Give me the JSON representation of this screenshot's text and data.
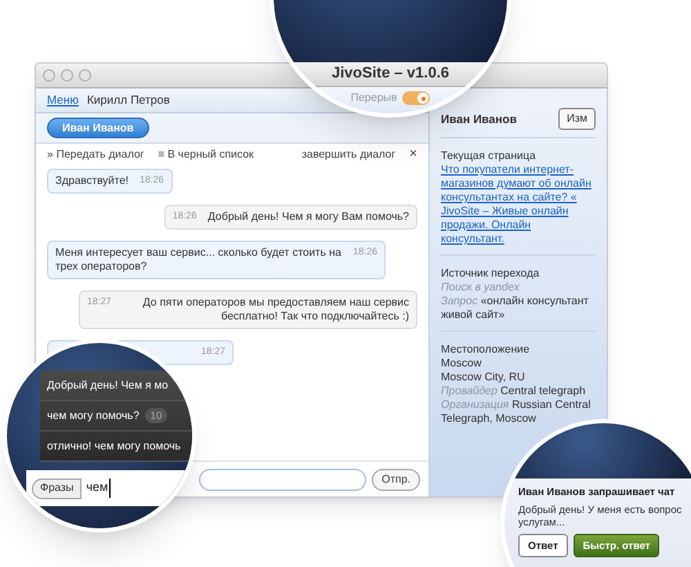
{
  "window": {
    "title": "JivoSite – v1.0.6"
  },
  "header": {
    "menu_link": "Меню",
    "operator": "Кирилл Петров",
    "break_label": "Перерыв",
    "break_on": true
  },
  "chat_tabs": [
    {
      "label": "Иван Иванов",
      "selected": true
    }
  ],
  "actions": [
    {
      "icon": "»",
      "label": "Передать диалог"
    },
    {
      "icon": "≡",
      "label": "В черный список"
    }
  ],
  "end_dialog": {
    "label": "завершить диалог",
    "close": "×"
  },
  "messages": [
    {
      "kind": "visitor",
      "text": "Здравствуйте!",
      "time": "18:26"
    },
    {
      "kind": "operator",
      "text": "Добрый день! Чем я могу Вам помочь?",
      "time": "18:26"
    },
    {
      "kind": "visitor",
      "text": "Меня интересует ваш сервис... сколько будет стоить на трех операторов?",
      "time": "18:26"
    },
    {
      "kind": "operator",
      "text": "До пяти операторов мы предоставляем наш сервис бесплатно! Так что подключайтесь :)",
      "time": "18:27"
    },
    {
      "kind": "visitor",
      "time": "18:27"
    }
  ],
  "phrases": [
    {
      "text": "Добрый день! Чем я мо"
    },
    {
      "text": "чем могу помочь?",
      "count": "10"
    },
    {
      "text": "отлично! чем могу помочь"
    }
  ],
  "composer": {
    "phrases_button": "Фразы",
    "value": "чем",
    "send": "Отпр."
  },
  "visitor": {
    "name": "Иван Иванов",
    "edit": "Изм",
    "sections": [
      {
        "title": "Текущая страница",
        "lines": [
          {
            "kind": "link",
            "value": "Что покупатели интернет-магазинов думают об онлайн консультантах на сайте? « JivoSite – Живые онлайн продажи. Онлайн консультант."
          }
        ]
      },
      {
        "title": "Источник перехода",
        "lines": [
          {
            "kind": "muted",
            "value": "Поиск в yandex"
          },
          {
            "kind": "pair",
            "label": "Запрос",
            "value": "«онлайн консультант живой сайт»"
          }
        ]
      },
      {
        "title": "Местоположение",
        "lines": [
          {
            "kind": "plain",
            "value": "Moscow"
          },
          {
            "kind": "plain",
            "value": "Moscow City, RU"
          },
          {
            "kind": "pair",
            "label": "Провайдер",
            "value": "Central telegraph"
          },
          {
            "kind": "pair",
            "label": "Организация",
            "value": "Russian Central Telegraph, Moscow"
          }
        ]
      }
    ]
  },
  "notification": {
    "title": "Иван Иванов запрашивает чат",
    "lines": [
      "Добрый день! У меня есть вопрос",
      "услугам..."
    ],
    "buttons": [
      {
        "label": "Ответ",
        "kind": "plain"
      },
      {
        "label": "Быстр. ответ",
        "kind": "primary"
      }
    ]
  }
}
